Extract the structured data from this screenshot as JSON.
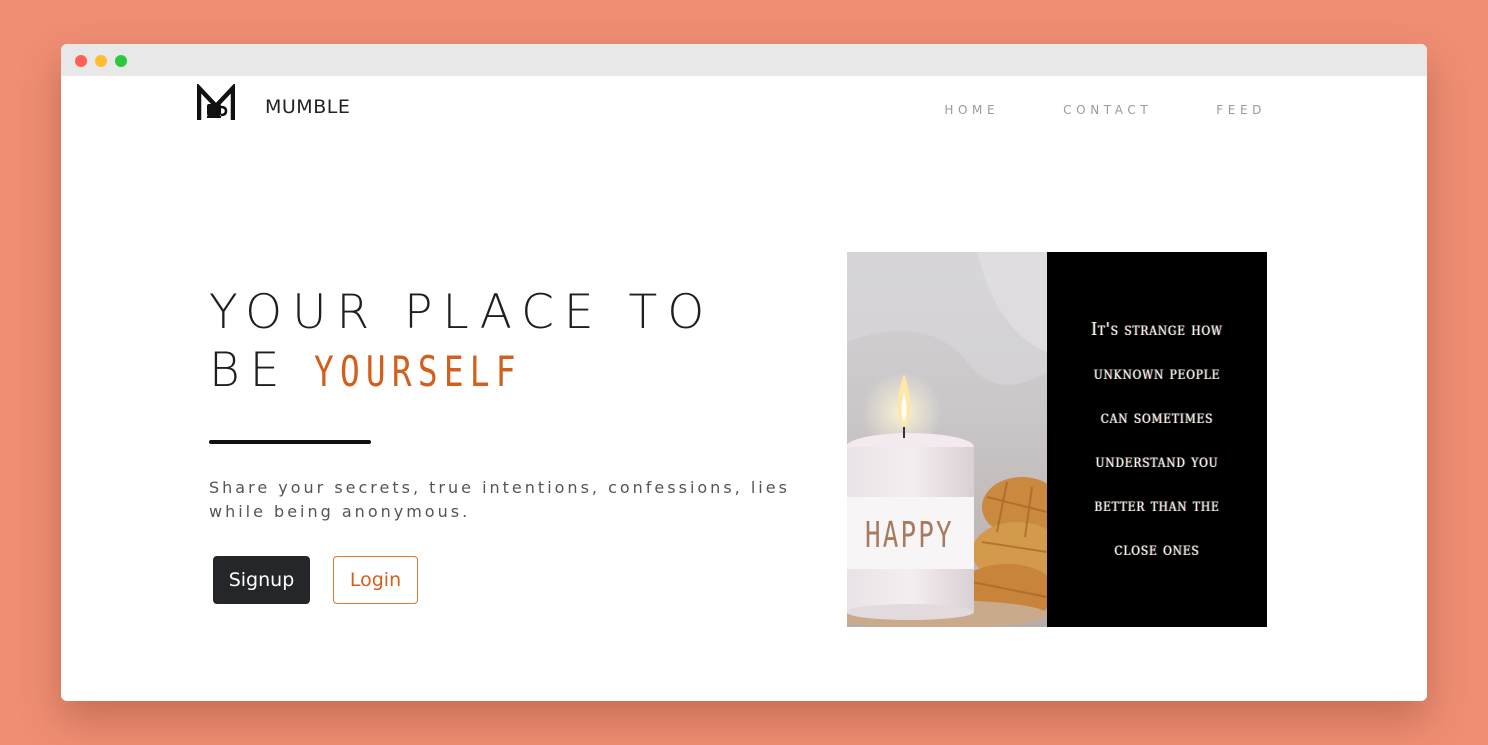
{
  "header": {
    "brand": "MUMBLE",
    "nav": [
      "HOME",
      "CONTACT",
      "FEED"
    ]
  },
  "hero": {
    "title_line1": "YOUR PLACE TO",
    "title_line2_prefix": "BE",
    "title_line2_accent": "YOURSELF",
    "tagline": "Share your secrets, true intentions, confessions, lies while being anonymous.",
    "signup_label": "Signup",
    "login_label": "Login"
  },
  "card": {
    "candle_label": "HAPPY",
    "quote": "It's strange how unknown people can sometimes understand you better than the close ones"
  },
  "colors": {
    "background": "#ef8e73",
    "accent": "#d35f1c",
    "dark": "#24262a"
  }
}
